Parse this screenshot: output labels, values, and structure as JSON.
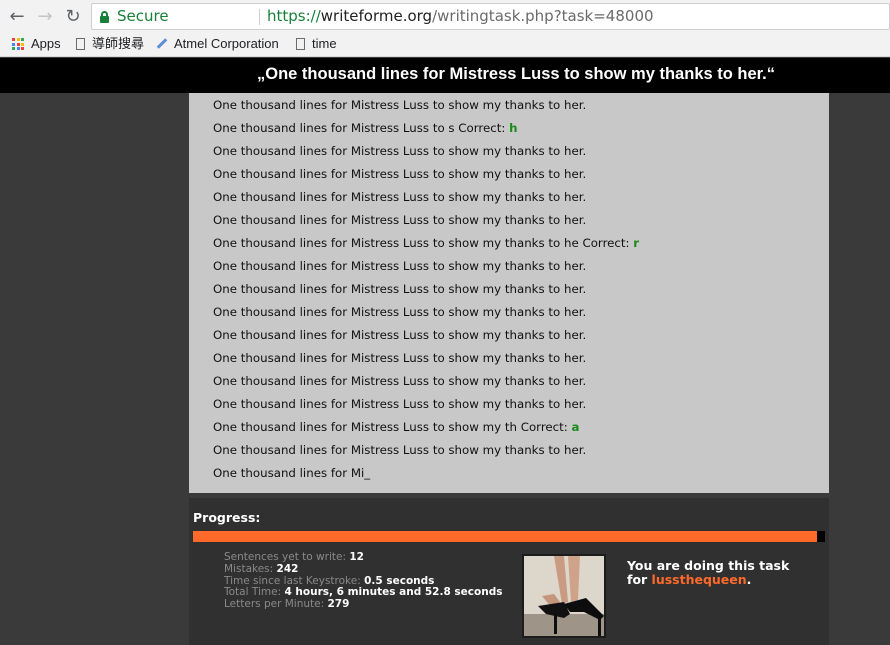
{
  "browser": {
    "secure_label": "Secure",
    "url_scheme": "https://",
    "url_host": "writeforme.org",
    "url_path": "/writingtask.php?task=48000",
    "back_icon": "arrow-left-icon",
    "forward_icon": "arrow-right-icon",
    "reload_icon": "reload-icon",
    "lock_icon": "lock-icon",
    "bookmarks": [
      {
        "label": "Apps",
        "icon": "apps-grid-icon"
      },
      {
        "label": "導師搜尋",
        "icon": "page-icon"
      },
      {
        "label": "Atmel Corporation",
        "icon": "pen-icon"
      },
      {
        "label": "time",
        "icon": "page-icon"
      }
    ],
    "colors": {
      "secure": "#188038",
      "apps": [
        "#ea4335",
        "#fbbc04",
        "#34a853",
        "#4285f4"
      ]
    }
  },
  "task": {
    "title": "„One thousand lines for Mistress Luss to show my thanks to her.“",
    "lines": [
      {
        "text": "One thousand lines for Mistress Luss to show my thanks to her.",
        "correct": ""
      },
      {
        "text": "One thousand lines for Mistress Luss to s Correct: ",
        "correct": "h"
      },
      {
        "text": "One thousand lines for Mistress Luss to show my thanks to her.",
        "correct": ""
      },
      {
        "text": "One thousand lines for Mistress Luss to show my thanks to her.",
        "correct": ""
      },
      {
        "text": "One thousand lines for Mistress Luss to show my thanks to her.",
        "correct": ""
      },
      {
        "text": "One thousand lines for Mistress Luss to show my thanks to her.",
        "correct": ""
      },
      {
        "text": "One thousand lines for Mistress Luss to show my thanks to he Correct: ",
        "correct": "r"
      },
      {
        "text": "One thousand lines for Mistress Luss to show my thanks to her.",
        "correct": ""
      },
      {
        "text": "One thousand lines for Mistress Luss to show my thanks to her.",
        "correct": ""
      },
      {
        "text": "One thousand lines for Mistress Luss to show my thanks to her.",
        "correct": ""
      },
      {
        "text": "One thousand lines for Mistress Luss to show my thanks to her.",
        "correct": ""
      },
      {
        "text": "One thousand lines for Mistress Luss to show my thanks to her.",
        "correct": ""
      },
      {
        "text": "One thousand lines for Mistress Luss to show my thanks to her.",
        "correct": ""
      },
      {
        "text": "One thousand lines for Mistress Luss to show my thanks to her.",
        "correct": ""
      },
      {
        "text": "One thousand lines for Mistress Luss to show my th Correct: ",
        "correct": "a"
      },
      {
        "text": "One thousand lines for Mistress Luss to show my thanks to her.",
        "correct": ""
      },
      {
        "text": "One thousand lines for Mi_",
        "correct": ""
      }
    ]
  },
  "progress": {
    "label": "Progress:",
    "fraction": 0.988,
    "color": "#ff6a2a"
  },
  "stats": {
    "sentences_label": "Sentences yet to write:",
    "sentences_value": "12",
    "mistakes_label": "Mistakes:",
    "mistakes_value": "242",
    "keystroke_label": "Time since last Keystroke:",
    "keystroke_value": "0.5 seconds",
    "total_label": "Total Time:",
    "total_value": "4 hours, 6 minutes and 52.8 seconds",
    "lpm_label": "Letters per Minute:",
    "lpm_value": "279"
  },
  "owner": {
    "line1": "You are doing this task",
    "line2_prefix": "for ",
    "username": "lussthequeen",
    "line2_suffix": "."
  }
}
